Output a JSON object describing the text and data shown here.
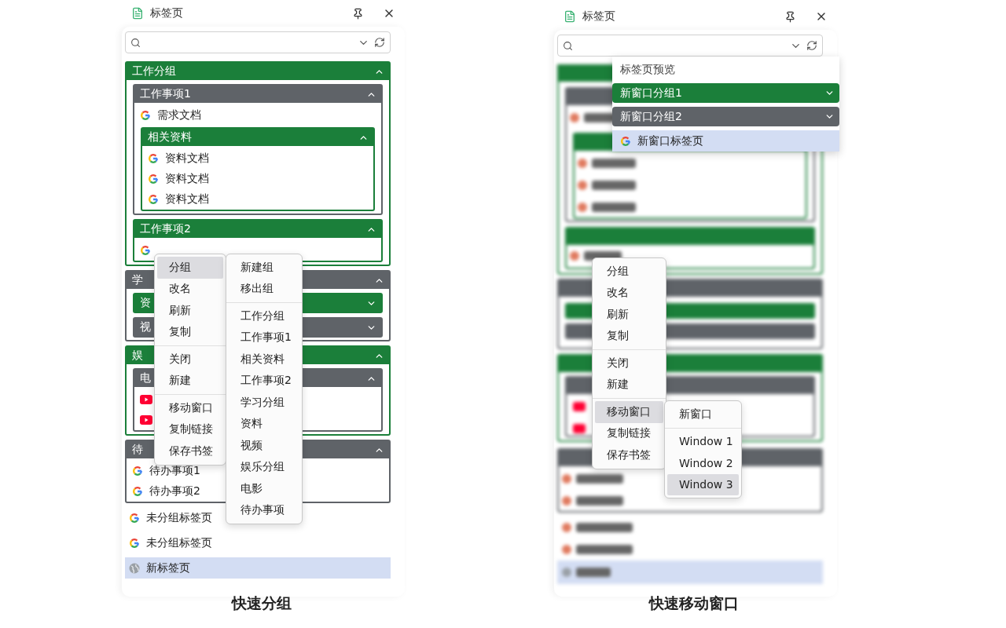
{
  "panels": [
    {
      "title": "标签页",
      "caption": "快速分组",
      "tree": [
        {
          "kind": "group",
          "label": "工作分组",
          "color": "#1b7f3a",
          "expanded": true,
          "children": [
            {
              "kind": "group",
              "label": "工作事项1",
              "color": "#5f6368",
              "expanded": true,
              "children": [
                {
                  "kind": "google",
                  "label": "需求文档",
                  "selected": false
                },
                {
                  "kind": "group",
                  "label": "相关资料",
                  "color": "#1b7f3a",
                  "expanded": true,
                  "children": [
                    {
                      "kind": "google",
                      "label": "资料文档",
                      "selected": false
                    },
                    {
                      "kind": "google",
                      "label": "资料文档",
                      "selected": false
                    },
                    {
                      "kind": "google",
                      "label": "资料文档",
                      "selected": false
                    }
                  ]
                }
              ]
            },
            {
              "kind": "group",
              "label": "工作事项2",
              "color": "#1b7f3a",
              "expanded": true,
              "children": [
                {
                  "kind": "google",
                  "selected": false
                }
              ]
            }
          ]
        },
        {
          "kind": "group",
          "label": "学",
          "color": "#5f6368",
          "expanded": true,
          "children": [
            {
              "kind": "group",
              "label": "资",
              "color": "#1b7f3a",
              "expanded": false
            },
            {
              "kind": "group",
              "label": "视",
              "color": "#5f6368",
              "expanded": false
            }
          ]
        },
        {
          "kind": "group",
          "label": "娱",
          "color": "#1b7f3a",
          "expanded": true,
          "children": [
            {
              "kind": "group",
              "label": "电",
              "color": "#5f6368",
              "expanded": true,
              "children": [
                {
                  "kind": "youtube",
                  "selected": false
                },
                {
                  "kind": "youtube",
                  "selected": false
                }
              ]
            }
          ]
        },
        {
          "kind": "group",
          "label": "待",
          "color": "#5f6368",
          "expanded": true,
          "children": [
            {
              "kind": "google",
              "label": "待办事项1",
              "selected": false
            },
            {
              "kind": "google",
              "label": "待办事项2",
              "selected": false
            }
          ]
        },
        {
          "kind": "google",
          "label": "未分组标签页",
          "selected": false
        },
        {
          "kind": "google",
          "label": "未分组标签页",
          "selected": false
        },
        {
          "kind": "globe",
          "label": "新标签页",
          "selected": true
        }
      ],
      "context_menu": {
        "sections": [
          [
            {
              "label": "分组",
              "selected": true
            },
            {
              "label": "改名",
              "selected": false
            },
            {
              "label": "刷新",
              "selected": false
            },
            {
              "label": "复制",
              "selected": false
            }
          ],
          [
            {
              "label": "关闭",
              "selected": false
            },
            {
              "label": "新建",
              "selected": false
            }
          ],
          [
            {
              "label": "移动窗口",
              "selected": false
            },
            {
              "label": "复制链接",
              "selected": false
            },
            {
              "label": "保存书签",
              "selected": false
            }
          ]
        ]
      },
      "submenu": {
        "sections": [
          [
            {
              "label": "新建组",
              "selected": false
            },
            {
              "label": "移出组",
              "selected": false
            }
          ],
          [
            {
              "label": "工作分组",
              "selected": false
            },
            {
              "label": "工作事项1",
              "selected": false
            },
            {
              "label": "相关资料",
              "selected": false
            },
            {
              "label": "工作事项2",
              "selected": false
            },
            {
              "label": "学习分组",
              "selected": false
            },
            {
              "label": "资料",
              "selected": false
            },
            {
              "label": "视频",
              "selected": false
            },
            {
              "label": "娱乐分组",
              "selected": false
            },
            {
              "label": "电影",
              "selected": false
            },
            {
              "label": "待办事项",
              "selected": false
            }
          ]
        ]
      }
    },
    {
      "title": "标签页",
      "caption": "快速移动窗口",
      "backdrop": {
        "kind": "blurred-list"
      },
      "preview": {
        "title": "标签页预览",
        "groups": [
          {
            "label": "新窗口分组1",
            "color": "#1b7f3a",
            "expanded": false
          },
          {
            "label": "新窗口分组2",
            "color": "#5f6368",
            "expanded": false
          }
        ],
        "tabs": [
          {
            "kind": "google",
            "label": "新窗口标签页",
            "selected": true
          }
        ]
      },
      "context_menu": {
        "sections": [
          [
            {
              "label": "分组",
              "selected": false
            },
            {
              "label": "改名",
              "selected": false
            },
            {
              "label": "刷新",
              "selected": false
            },
            {
              "label": "复制",
              "selected": false
            }
          ],
          [
            {
              "label": "关闭",
              "selected": false
            },
            {
              "label": "新建",
              "selected": false
            }
          ],
          [
            {
              "label": "移动窗口",
              "selected": true
            },
            {
              "label": "复制链接",
              "selected": false
            },
            {
              "label": "保存书签",
              "selected": false
            }
          ]
        ]
      },
      "submenu": {
        "sections": [
          [
            {
              "label": "新窗口",
              "selected": false
            }
          ],
          [
            {
              "label": "Window 1",
              "selected": false
            },
            {
              "label": "Window 2",
              "selected": false
            },
            {
              "label": "Window 3",
              "selected": true
            }
          ]
        ]
      }
    }
  ]
}
